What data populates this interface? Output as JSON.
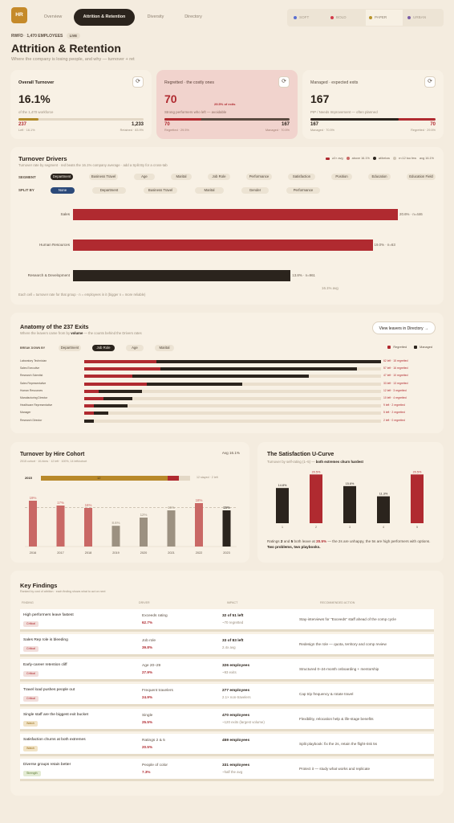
{
  "app": {
    "logo": "HR"
  },
  "nav": {
    "tabs": [
      "Overview",
      "Attrition & Retention",
      "Diversity",
      "Directory"
    ],
    "active": 1
  },
  "themes": [
    {
      "label": "SOFT",
      "color": "#5b6fd1"
    },
    {
      "label": "BOLD",
      "color": "#d23b4a"
    },
    {
      "label": "PAPER",
      "color": "#b8932a"
    },
    {
      "label": "URBAN",
      "color": "#7b5ea7"
    }
  ],
  "header": {
    "org": "RWFD",
    "employees": "1,470 EMPLOYEES",
    "live": "LIVE",
    "title": "Attrition & Retention",
    "subtitle": "Where the company is losing people, and why — turnover + ret"
  },
  "kpis": [
    {
      "label": "Overall Turnover",
      "value": "16.1%",
      "sub": "of the 1,470 workforce",
      "left_val": "237",
      "left_cap": "Left · 16.1%",
      "right_val": "1,233",
      "right_cap": "Retained · 83.9%",
      "fill": 0.161
    },
    {
      "label": "Regretted · the costly ones",
      "value": "70",
      "badge": "29.5% of exits",
      "sub": "Strong performers who left — avoidable",
      "left_val": "70",
      "left_cap": "Regretted · 29.5%",
      "right_val": "167",
      "right_cap": "Managed · 70.5%",
      "fill": 0.295
    },
    {
      "label": "Managed · expected exits",
      "value": "167",
      "sub": "PIP / Needs Improvement — often planned",
      "left_val": "167",
      "left_cap": "Managed · 70.5%",
      "right_val": "70",
      "right_cap": "Regretted · 29.5%",
      "fill": 0.705
    }
  ],
  "drivers": {
    "title": "Turnover Drivers",
    "subtitle": "Turnover rate by segment · red beats the 16.1% company average · add a Split By for a cross-tab",
    "legend": [
      "≥2× avg",
      "above 16.1%",
      "at/below",
      "n<12 too few",
      "avg 16.1%"
    ],
    "segment_label": "SEGMENT",
    "segments": [
      "Department",
      "Business Travel",
      "Age",
      "Marital",
      "Job Role",
      "Performance",
      "Satisfaction",
      "Position",
      "Education",
      "Education Field"
    ],
    "split_label": "SPLIT BY",
    "splits": [
      "None",
      "Department",
      "Business Travel",
      "Marital",
      "Gender",
      "Performance"
    ],
    "bars": [
      {
        "label": "Sales",
        "value": 20.6,
        "text": "20.6% · n=446",
        "color": "#b02a30"
      },
      {
        "label": "Human Resources",
        "value": 19.0,
        "text": "19.0% · n=63",
        "color": "#b02a30"
      },
      {
        "label": "Research & Development",
        "value": 13.8,
        "text": "13.8% · n=961",
        "color": "#2b241d"
      }
    ],
    "avg_label": "16.1% avg",
    "footnote": "Each cell = turnover rate for that group · n = employees in it (bigger n = more reliable)"
  },
  "anatomy": {
    "title": "Anatomy of the 237 Exits",
    "subtitle_pre": "Where the leavers came from by ",
    "subtitle_bold": "volume",
    "subtitle_post": " — the counts behind the Drivers rates",
    "button": "View leavers in Directory →",
    "breakdown_label": "BREAK DOWN BY",
    "tabs": [
      "Department",
      "Job Role",
      "Age",
      "Marital"
    ],
    "active_tab": 1,
    "legend": [
      "Regretted",
      "Managed"
    ],
    "rows": [
      {
        "role": "Laboratory Technician",
        "total": 62,
        "regretted": 15,
        "text": "62 left · 15 regretted"
      },
      {
        "role": "Sales Executive",
        "total": 57,
        "regretted": 16,
        "text": "57 left · 16 regretted"
      },
      {
        "role": "Research Scientist",
        "total": 47,
        "regretted": 10,
        "text": "47 left · 10 regretted"
      },
      {
        "role": "Sales Representative",
        "total": 33,
        "regretted": 13,
        "text": "33 left · 13 regretted"
      },
      {
        "role": "Human Resources",
        "total": 12,
        "regretted": 3,
        "text": "12 left · 3 regretted"
      },
      {
        "role": "Manufacturing Director",
        "total": 10,
        "regretted": 4,
        "text": "10 left · 4 regretted"
      },
      {
        "role": "Healthcare Representative",
        "total": 9,
        "regretted": 2,
        "text": "9 left · 2 regretted"
      },
      {
        "role": "Manager",
        "total": 5,
        "regretted": 2,
        "text": "5 left · 2 regretted"
      },
      {
        "role": "Research Director",
        "total": 2,
        "regretted": 0,
        "text": "2 left · 0 regretted"
      }
    ]
  },
  "cohort": {
    "title": "Turnover by Hire Cohort",
    "subtitle": "2015 cohort · 10-hires · 12 left · 100%, 14 left/cohort",
    "avg_tag": "Avg 16.1%",
    "track_year": "2015",
    "track_value": "12",
    "track_note": "12 stayed · 2 left",
    "chart_data": {
      "type": "bar",
      "categories": [
        "2016",
        "2017",
        "2018",
        "2019",
        "2020",
        "2021",
        "2022",
        "2023"
      ],
      "values": [
        19,
        17,
        16,
        8.6,
        12,
        15,
        18,
        15
      ],
      "labels": [
        "19%",
        "17%",
        "16%",
        "8.6%",
        "12%",
        "15%",
        "18%",
        "15%"
      ],
      "colors": [
        "#c96865",
        "#c96865",
        "#c96865",
        "#9c9181",
        "#9c9181",
        "#9c9181",
        "#c96865",
        "#2b241d"
      ],
      "ylim": [
        0,
        25
      ],
      "average": 16.1
    }
  },
  "satisfaction": {
    "title": "The Satisfaction U-Curve",
    "subtitle_pre": "Turnover by self-rating (1–5) — ",
    "subtitle_bold": "both extremes churn hardest",
    "chart_data": {
      "type": "bar",
      "categories": [
        "1",
        "2",
        "3",
        "4",
        "5"
      ],
      "values": [
        14.8,
        20.5,
        15.6,
        11.3,
        20.5
      ],
      "labels": [
        "14.8%",
        "20.5%",
        "15.6%",
        "11.3%",
        "20.5%"
      ],
      "colors": [
        "#2b241d",
        "#b02a30",
        "#2b241d",
        "#2b241d",
        "#b02a30"
      ],
      "ylim": [
        0,
        25
      ]
    },
    "note_pre": "Ratings ",
    "note_b1": "2",
    "note_mid1": " and ",
    "note_b2": "5",
    "note_mid2": " both leave at ",
    "note_b3": "20.5%",
    "note_mid3": " — the 2s are unhappy, the 5s are high performers with options. ",
    "note_b4": "Two problems, two playbooks."
  },
  "findings": {
    "title": "Key Findings",
    "subtitle": "Ranked by cost of attrition · each finding shows what to act on next",
    "columns": [
      "FINDING",
      "DRIVER",
      "IMPACT",
      "RECOMMENDED ACTION"
    ],
    "rows": [
      {
        "finding": "High performers leave fastest",
        "tag": "Critical",
        "tag_kind": "red",
        "driver": "Exceeds rating",
        "driver_val": "62.7%",
        "impact": "32 of 51 left",
        "impact_sub": "~70 regretted",
        "action": "Stay-interviews for \"Exceeds\" staff ahead of the comp cycle"
      },
      {
        "finding": "Sales Rep role is bleeding",
        "tag": "Critical",
        "tag_kind": "red",
        "driver": "Job role",
        "driver_val": "39.8%",
        "impact": "33 of 83 left",
        "impact_sub": "2.4x avg",
        "action": "Redesign the role — quota, territory and comp review"
      },
      {
        "finding": "Early-career retention cliff",
        "tag": "Critical",
        "tag_kind": "red",
        "driver": "Age 20–29",
        "driver_val": "27.9%",
        "impact": "326 employees",
        "impact_sub": "~93 exits",
        "action": "Structured 0–24-month onboarding + mentorship"
      },
      {
        "finding": "Travel load pushes people out",
        "tag": "Critical",
        "tag_kind": "red",
        "driver": "Frequent travelers",
        "driver_val": "24.9%",
        "impact": "277 employees",
        "impact_sub": "2.1× non-travelers",
        "action": "Cap trip frequency & rotate travel"
      },
      {
        "finding": "Single staff are the biggest exit bucket",
        "tag": "Watch",
        "tag_kind": "amber",
        "driver": "Single",
        "driver_val": "25.5%",
        "impact": "470 employees",
        "impact_sub": "~120 exits (largest volume)",
        "action": "Flexibility, relocation help & life-stage benefits"
      },
      {
        "finding": "Satisfaction churns at both extremes",
        "tag": "Watch",
        "tag_kind": "amber",
        "driver": "Ratings 2 & 5",
        "driver_val": "20.5%",
        "impact": "459 employees",
        "impact_sub": "",
        "action": "Split playbook: fix the 2s, retain the flight-risk 5s"
      },
      {
        "finding": "Diverse groups retain better",
        "tag": "Strength",
        "tag_kind": "green",
        "driver": "People of color",
        "driver_val": "7.3%",
        "impact": "331 employees",
        "impact_sub": "~half the avg",
        "action": "Protect it — study what works and replicate"
      }
    ]
  }
}
